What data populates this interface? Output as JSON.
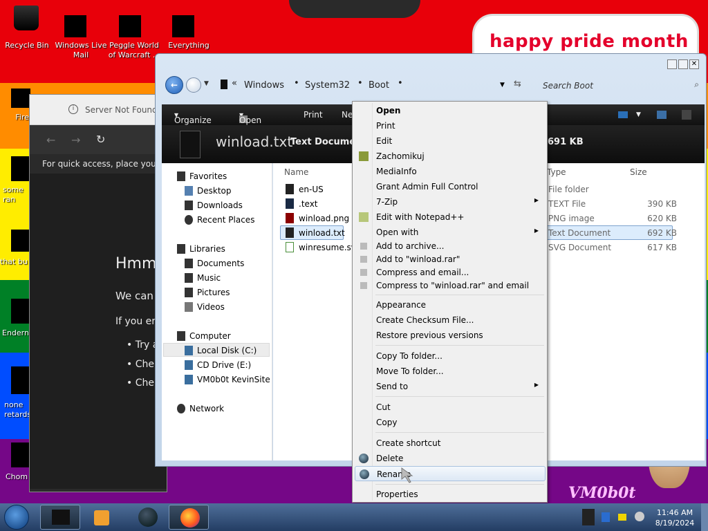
{
  "desktop": {
    "icons": [
      {
        "label": "Recycle Bin"
      },
      {
        "label": "Windows Live Mail"
      },
      {
        "label": "Peggle World of Warcraft ..."
      },
      {
        "label": "Everything"
      }
    ],
    "partial_icons": [
      "Fire",
      "some ran",
      "that bu",
      "Endern",
      "none retards",
      "Chom"
    ],
    "banner": "happy pride month",
    "watermark": "VM0b0t"
  },
  "browser": {
    "tab_title": "Server Not Found",
    "bookmark_hint": "For quick access, place your bo",
    "heading": "Hmm",
    "line1": "We can",
    "line2": "If you er",
    "bullets": [
      "Try a",
      "Che",
      "Che"
    ]
  },
  "explorer": {
    "breadcrumbs": [
      "Windows",
      "System32",
      "Boot"
    ],
    "search_placeholder": "Search Boot",
    "toolbar": {
      "organize": "Organize",
      "open": "Open",
      "print": "Print",
      "new": "Ne"
    },
    "preview": {
      "filename": "winload.txt",
      "type": "Text Documen",
      "size": "691 KB"
    },
    "nav": {
      "favorites": "Favorites",
      "favorites_items": [
        "Desktop",
        "Downloads",
        "Recent Places"
      ],
      "libraries": "Libraries",
      "libraries_items": [
        "Documents",
        "Music",
        "Pictures",
        "Videos"
      ],
      "computer": "Computer",
      "computer_items": [
        "Local Disk (C:)",
        "CD Drive (E:)",
        "VM0b0t KevinSite"
      ],
      "network": "Network"
    },
    "columns": {
      "name": "Name",
      "type": "Type",
      "size": "Size"
    },
    "files": [
      {
        "name": "en-US",
        "type": "File folder",
        "size": ""
      },
      {
        "name": ".text",
        "type": "TEXT File",
        "size": "390 KB"
      },
      {
        "name": "winload.png",
        "type": "PNG image",
        "size": "620 KB"
      },
      {
        "name": "winload.txt",
        "type": "Text Document",
        "size": "692 KB"
      },
      {
        "name": "winresume.svg",
        "type": "SVG Document",
        "size": "617 KB"
      }
    ]
  },
  "context_menu": {
    "items": [
      "Open",
      "Print",
      "Edit",
      "Zachomikuj",
      "MediaInfo",
      "Grant Admin Full Control",
      "7-Zip",
      "Edit with Notepad++",
      "Open with",
      "Add to archive...",
      "Add to \"winload.rar\"",
      "Compress and email...",
      "Compress to \"winload.rar\" and email",
      "Appearance",
      "Create Checksum File...",
      "Restore previous versions",
      "Copy To folder...",
      "Move To folder...",
      "Send to",
      "Cut",
      "Copy",
      "Create shortcut",
      "Delete",
      "Rename",
      "Properties"
    ]
  },
  "taskbar": {
    "time": "11:46 AM",
    "date": "8/19/2024"
  },
  "colors": {
    "accent_selection": "#cce8ff",
    "menu_hover_border": "#a9c2df",
    "banner_text": "#e4002b"
  }
}
